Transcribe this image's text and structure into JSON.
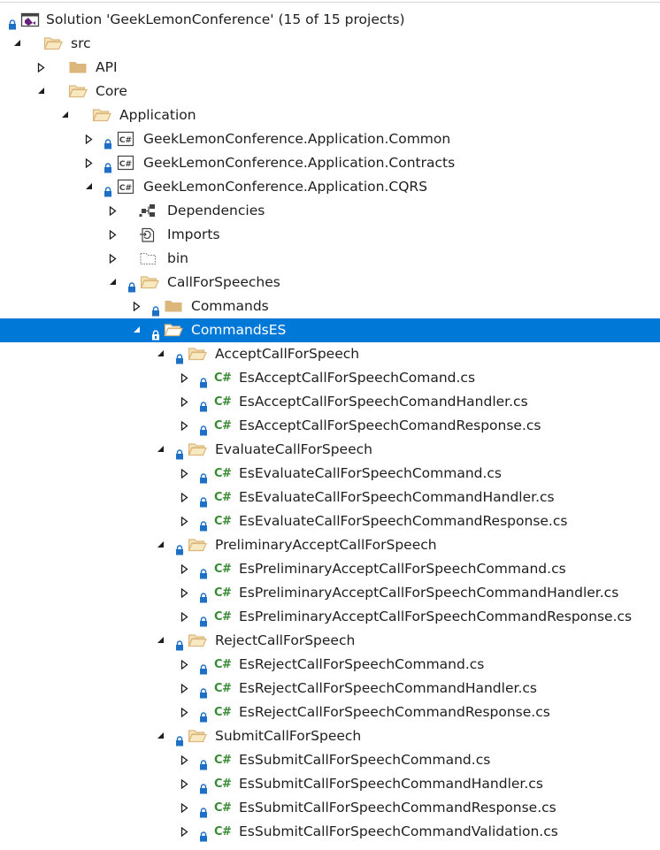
{
  "solution": {
    "label": "Solution 'GeekLemonConference' (15 of 15 projects)"
  },
  "src": {
    "label": "src"
  },
  "api": {
    "label": "API"
  },
  "core": {
    "label": "Core"
  },
  "application": {
    "label": "Application"
  },
  "projects": {
    "common": {
      "label": "GeekLemonConference.Application.Common"
    },
    "contracts": {
      "label": "GeekLemonConference.Application.Contracts"
    },
    "cqrs": {
      "label": "GeekLemonConference.Application.CQRS"
    }
  },
  "cqrs_nodes": {
    "dependencies": {
      "label": "Dependencies"
    },
    "imports": {
      "label": "Imports"
    },
    "bin": {
      "label": "bin"
    },
    "callforspeeches": {
      "label": "CallForSpeeches"
    },
    "commands": {
      "label": "Commands"
    },
    "commandses": {
      "label": "CommandsES"
    }
  },
  "cs_glyph": "C#",
  "groups": [
    {
      "folder": "AcceptCallForSpeech",
      "files": [
        "EsAcceptCallForSpeechComand.cs",
        "EsAcceptCallForSpeechComandHandler.cs",
        "EsAcceptCallForSpeechComandResponse.cs"
      ]
    },
    {
      "folder": "EvaluateCallForSpeech",
      "files": [
        "EsEvaluateCallForSpeechCommand.cs",
        "EsEvaluateCallForSpeechCommandHandler.cs",
        "EsEvaluateCallForSpeechCommandResponse.cs"
      ]
    },
    {
      "folder": "PreliminaryAcceptCallForSpeech",
      "files": [
        "EsPreliminaryAcceptCallForSpeechCommand.cs",
        "EsPreliminaryAcceptCallForSpeechCommandHandler.cs",
        "EsPreliminaryAcceptCallForSpeechCommandResponse.cs"
      ]
    },
    {
      "folder": "RejectCallForSpeech",
      "files": [
        "EsRejectCallForSpeechCommand.cs",
        "EsRejectCallForSpeechCommandHandler.cs",
        "EsRejectCallForSpeechCommandResponse.cs"
      ]
    },
    {
      "folder": "SubmitCallForSpeech",
      "files": [
        "EsSubmitCallForSpeechCommand.cs",
        "EsSubmitCallForSpeechCommandHandler.cs",
        "EsSubmitCallForSpeechCommandResponse.cs",
        "EsSubmitCallForSpeechCommandValidation.cs"
      ]
    }
  ],
  "colors": {
    "selection": "#0078d7",
    "folder": "#dcb67a",
    "lock": "#1e6fc6",
    "csharp": "#388a34",
    "solution_icon": "#68217a"
  },
  "icons": {
    "solution": "visual-studio-solution-icon",
    "folder_open": "folder-open-icon",
    "folder_closed": "folder-closed-icon",
    "project": "csharp-project-icon",
    "dependencies": "dependencies-icon",
    "imports": "imports-icon",
    "bin": "dotted-folder-icon",
    "csharp_file": "csharp-file-icon",
    "lock": "padlock-icon",
    "expanded": "expanded-triangle-icon",
    "collapsed": "collapsed-triangle-icon"
  }
}
